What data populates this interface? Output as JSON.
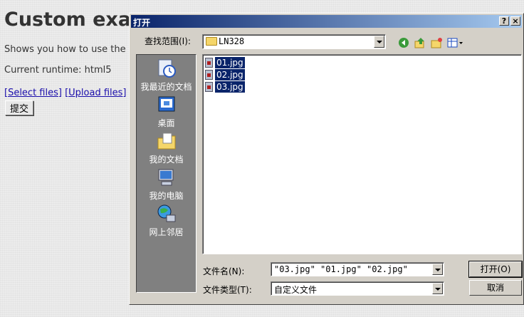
{
  "page": {
    "title": "Custom exa",
    "description": "Shows you how to use the",
    "runtime": "Current runtime: html5",
    "select_files": "[Select files]",
    "upload_files": "[Upload files]",
    "submit_label": "提交"
  },
  "dialog": {
    "title": "打开",
    "help_label": "?",
    "close_label": "×",
    "lookin_label": "查找范围(I):",
    "lookin_value": "LN328",
    "places": [
      {
        "label": "我最近的文档",
        "icon": "recent-documents-icon"
      },
      {
        "label": "桌面",
        "icon": "desktop-icon"
      },
      {
        "label": "我的文档",
        "icon": "my-documents-icon"
      },
      {
        "label": "我的电脑",
        "icon": "my-computer-icon"
      },
      {
        "label": "网上邻居",
        "icon": "network-places-icon"
      }
    ],
    "files": [
      "01.jpg",
      "02.jpg",
      "03.jpg"
    ],
    "filename_label": "文件名(N):",
    "filename_value": "\"03.jpg\" \"01.jpg\" \"02.jpg\"",
    "filetype_label": "文件类型(T):",
    "filetype_value": "自定义文件",
    "open_label": "打开(O)",
    "cancel_label": "取消"
  }
}
